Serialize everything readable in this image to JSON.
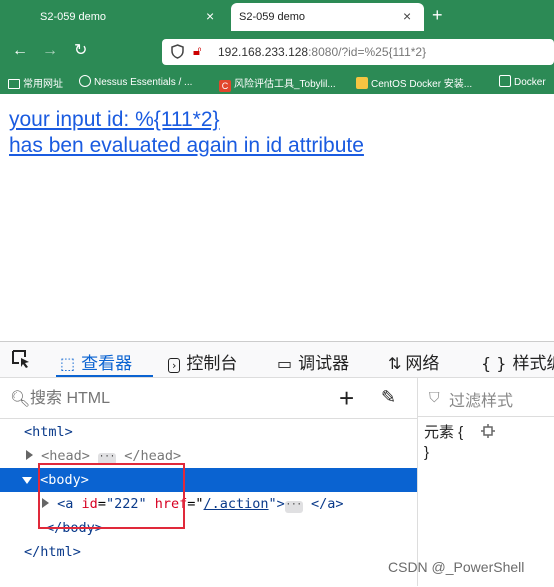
{
  "browser": {
    "tabs": [
      {
        "title": "S2-059 demo",
        "close": "×"
      },
      {
        "title": "S2-059 demo",
        "close": "×"
      }
    ],
    "new_tab": "+",
    "nav": {
      "back": "←",
      "forward": "→",
      "reload": "↻"
    },
    "url_host": "192.168.233.128",
    "url_rest": ":8080/?id=%25{111*2}",
    "bookmarks": [
      {
        "label": "常用网址",
        "icon": "folder-icon",
        "color": "#ffffff"
      },
      {
        "label": "Nessus Essentials / ...",
        "icon": "globe-icon",
        "color": "#ffffff"
      },
      {
        "label": "风险评估工具_Tobylil...",
        "icon": "c-logo-icon",
        "color": "#e2462c"
      },
      {
        "label": "CentOS Docker 安装...",
        "icon": "site-icon",
        "color": "#f5c542"
      },
      {
        "label": "Docker",
        "icon": "docker-icon",
        "color": "#ffffff"
      }
    ]
  },
  "page": {
    "line1": "your input id: %{111*2}",
    "line2": "has ben evaluated again in id attribute"
  },
  "devtools": {
    "tabs": [
      {
        "label": "",
        "icon": "pick-element-icon"
      },
      {
        "label": "查看器",
        "icon": "inspector-icon"
      },
      {
        "label": "控制台",
        "icon": "console-icon"
      },
      {
        "label": "调试器",
        "icon": "debugger-icon"
      },
      {
        "label": "网络",
        "icon": "network-icon"
      },
      {
        "label": "样式编",
        "icon": "style-editor-icon"
      }
    ],
    "search_placeholder": "搜索 HTML",
    "filter_placeholder": "过滤样式",
    "tree": {
      "html_open": "<html>",
      "head_open": "<head>",
      "head_close": "</head>",
      "body_open": "<body>",
      "a_open": "<a",
      "a_id_attr": "id",
      "a_id_val": "\"222\"",
      "a_href_attr": "href",
      "a_href_val": "/.action",
      "a_close": "</a>",
      "body_close": "</body>",
      "html_close": "</html>",
      "ellipsis": "···"
    },
    "rules": {
      "element_label": "元素 {",
      "close_brace": "}"
    }
  },
  "watermark": "CSDN @_PowerShell",
  "colors": {
    "chrome_green": "#2c8a55",
    "link_blue": "#1a5be0",
    "selection_blue": "#0a63d1",
    "highlight_red": "#e0293a"
  }
}
